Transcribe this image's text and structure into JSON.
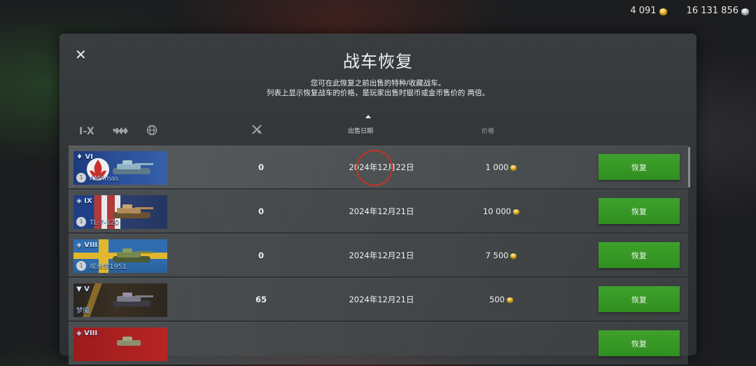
{
  "currencies": [
    {
      "value": "4 091",
      "icon": "gold-coin-icon",
      "color": "#e2b323"
    },
    {
      "value": "16 131 856",
      "icon": "silver-coin-icon",
      "color": "#b8c0c6"
    }
  ],
  "dialog": {
    "title": "战车恢复",
    "subtitle_line1": "您可在此恢复之前出售的特种/收藏战车。",
    "subtitle_line2": "列表上显示恢复战车的价格，是玩家出售时银币或金币售价的 两倍。"
  },
  "filters": {
    "tier_label": "I-X"
  },
  "columns": {
    "date": "出售日期",
    "price": "价格"
  },
  "rows": [
    {
      "tier": "♦ VI",
      "name": "AMXmas",
      "kills": "0",
      "date": "2024年12月22日",
      "price": "1 000",
      "button": "恢复",
      "crest": "1"
    },
    {
      "tier": "◈ IX",
      "name": "TL-7-120",
      "kills": "0",
      "date": "2024年12月21日",
      "price": "10 000",
      "button": "恢复",
      "crest": "1"
    },
    {
      "tier": "◈ VIII",
      "name": "埃米尔1951",
      "kills": "0",
      "date": "2024年12月21日",
      "price": "7 500",
      "button": "恢复",
      "crest": "1"
    },
    {
      "tier": "▼ V",
      "name": "梦魇",
      "kills": "65",
      "date": "2024年12月21日",
      "price": "500",
      "button": "恢复"
    },
    {
      "tier": "◈ VIII",
      "name": "",
      "kills": "",
      "date": "",
      "price": "",
      "button": "恢复"
    }
  ],
  "colors": {
    "accent_green": "#3fa12c",
    "panel_bg": "#34373a",
    "gold": "#e2b323"
  }
}
